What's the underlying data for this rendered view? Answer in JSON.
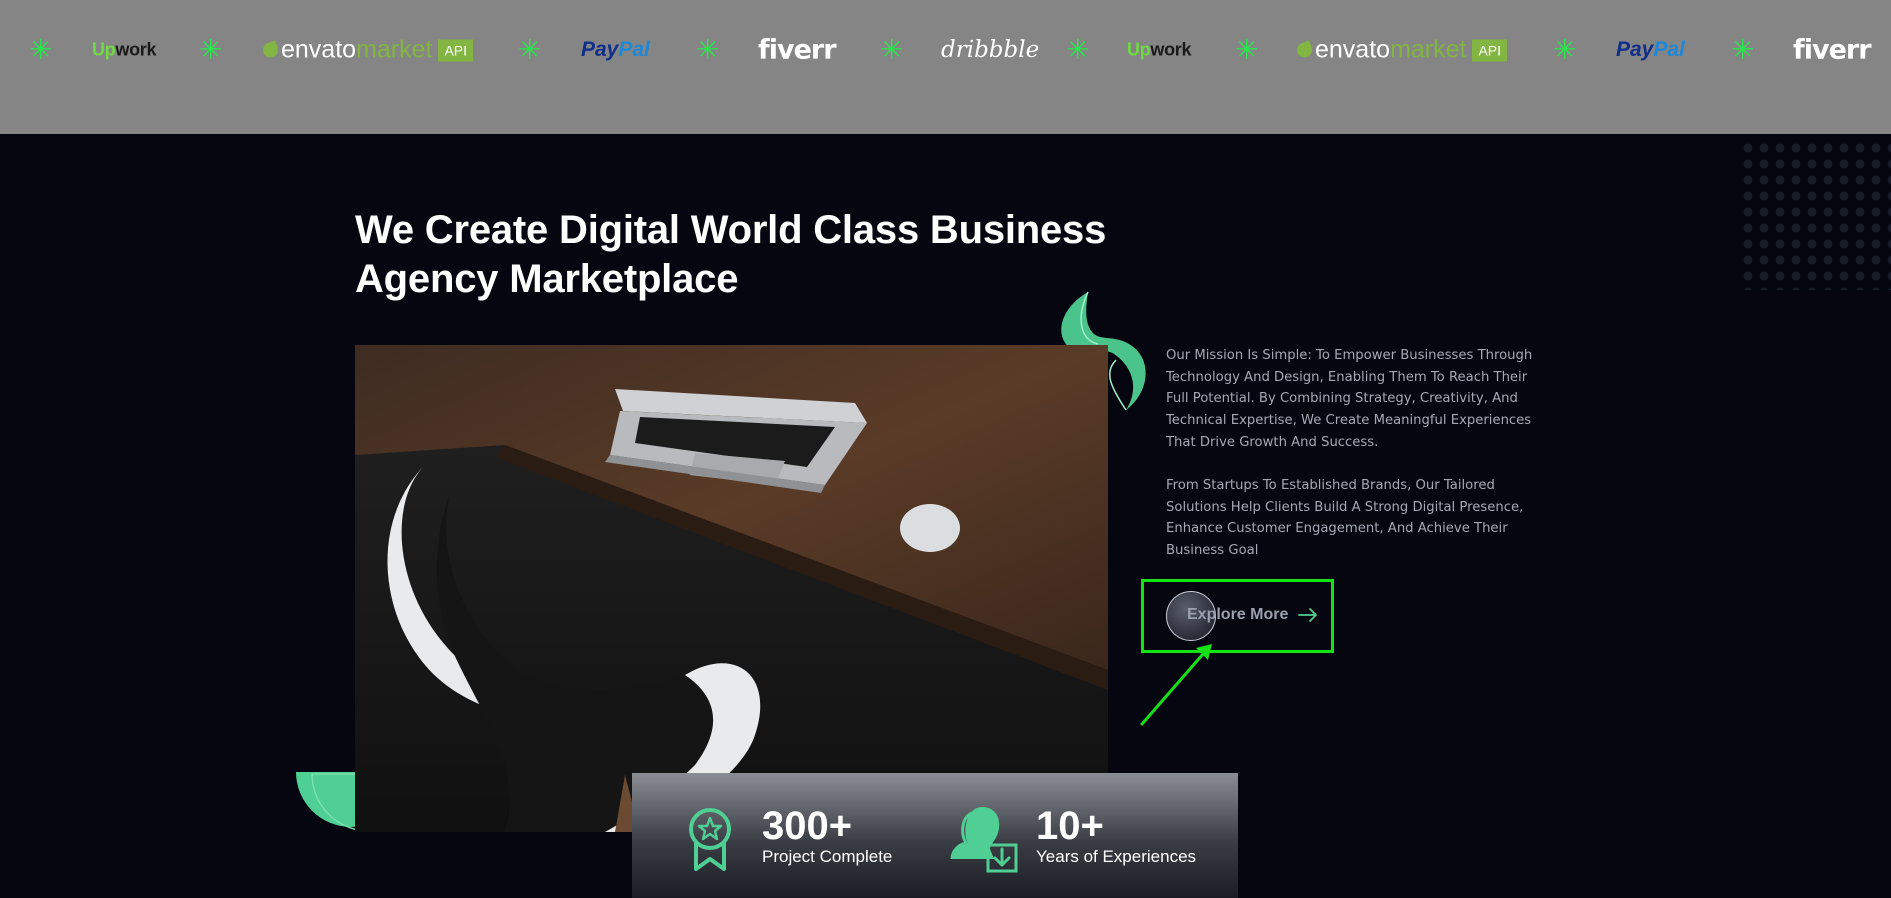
{
  "logo_strip": {
    "separator_icon": "star-burst-icon",
    "logos": [
      {
        "kind": "upwork",
        "part1": "Up",
        "part2": "work"
      },
      {
        "kind": "envato",
        "part1": "envato",
        "part2": "market",
        "badge": "API"
      },
      {
        "kind": "paypal",
        "part1": "Pay",
        "part2": "Pal"
      },
      {
        "kind": "fiverr",
        "text": "fiverr"
      },
      {
        "kind": "dribbble",
        "text": "dribbble"
      },
      {
        "kind": "upwork",
        "part1": "Up",
        "part2": "work"
      },
      {
        "kind": "envato",
        "part1": "envato",
        "part2": "market",
        "badge": "API"
      },
      {
        "kind": "paypal",
        "part1": "Pay",
        "part2": "Pal"
      },
      {
        "kind": "fiverr",
        "text": "fiverr"
      }
    ]
  },
  "hero": {
    "headline_line1": "We Create Digital World Class Business",
    "headline_line2": "Agency Marketplace",
    "paragraph_1": "Our Mission Is Simple: To Empower Businesses Through Technology And Design, Enabling Them To Reach Their Full Potential. By Combining Strategy, Creativity, And Technical Expertise, We Create Meaningful Experiences That Drive Growth And Success.",
    "paragraph_2": "From Startups To Established Brands, Our Tailored Solutions Help Clients Build A Strong Digital Presence, Enhance Customer Engagement, And Achieve Their Business Goal",
    "explore_label": "Explore More",
    "explore_icon": "arrow-right-icon"
  },
  "stats": [
    {
      "value": "300+",
      "label": "Project Complete",
      "icon": "award-badge-icon"
    },
    {
      "value": "10+",
      "label": "Years of Experiences",
      "icon": "user-download-icon"
    }
  ],
  "colors": {
    "page_background": "#05060f",
    "strip_background": "#858585",
    "accent_green": "#4fcf93",
    "highlight_green": "#15e215",
    "star_green": "#27e84a"
  }
}
